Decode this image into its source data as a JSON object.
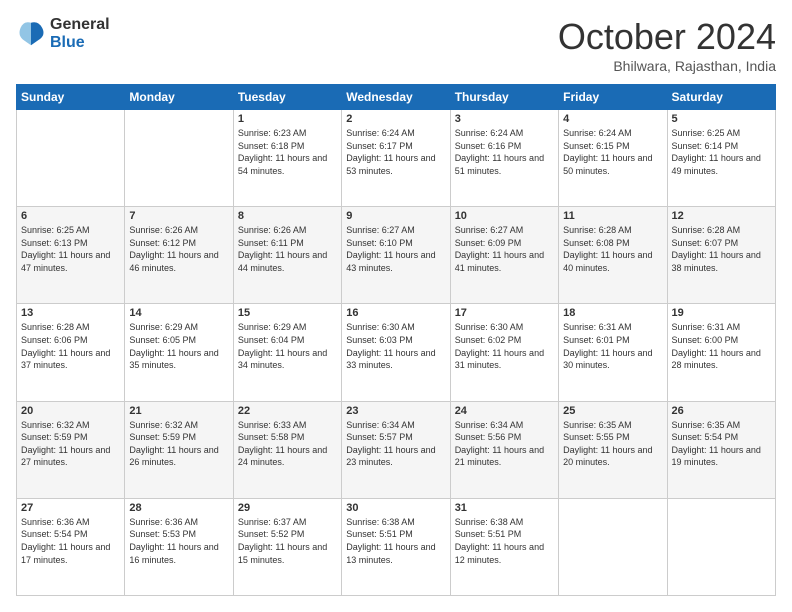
{
  "logo": {
    "general": "General",
    "blue": "Blue"
  },
  "header": {
    "month": "October 2024",
    "location": "Bhilwara, Rajasthan, India"
  },
  "weekdays": [
    "Sunday",
    "Monday",
    "Tuesday",
    "Wednesday",
    "Thursday",
    "Friday",
    "Saturday"
  ],
  "weeks": [
    [
      {
        "day": "",
        "info": ""
      },
      {
        "day": "",
        "info": ""
      },
      {
        "day": "1",
        "info": "Sunrise: 6:23 AM\nSunset: 6:18 PM\nDaylight: 11 hours and 54 minutes."
      },
      {
        "day": "2",
        "info": "Sunrise: 6:24 AM\nSunset: 6:17 PM\nDaylight: 11 hours and 53 minutes."
      },
      {
        "day": "3",
        "info": "Sunrise: 6:24 AM\nSunset: 6:16 PM\nDaylight: 11 hours and 51 minutes."
      },
      {
        "day": "4",
        "info": "Sunrise: 6:24 AM\nSunset: 6:15 PM\nDaylight: 11 hours and 50 minutes."
      },
      {
        "day": "5",
        "info": "Sunrise: 6:25 AM\nSunset: 6:14 PM\nDaylight: 11 hours and 49 minutes."
      }
    ],
    [
      {
        "day": "6",
        "info": "Sunrise: 6:25 AM\nSunset: 6:13 PM\nDaylight: 11 hours and 47 minutes."
      },
      {
        "day": "7",
        "info": "Sunrise: 6:26 AM\nSunset: 6:12 PM\nDaylight: 11 hours and 46 minutes."
      },
      {
        "day": "8",
        "info": "Sunrise: 6:26 AM\nSunset: 6:11 PM\nDaylight: 11 hours and 44 minutes."
      },
      {
        "day": "9",
        "info": "Sunrise: 6:27 AM\nSunset: 6:10 PM\nDaylight: 11 hours and 43 minutes."
      },
      {
        "day": "10",
        "info": "Sunrise: 6:27 AM\nSunset: 6:09 PM\nDaylight: 11 hours and 41 minutes."
      },
      {
        "day": "11",
        "info": "Sunrise: 6:28 AM\nSunset: 6:08 PM\nDaylight: 11 hours and 40 minutes."
      },
      {
        "day": "12",
        "info": "Sunrise: 6:28 AM\nSunset: 6:07 PM\nDaylight: 11 hours and 38 minutes."
      }
    ],
    [
      {
        "day": "13",
        "info": "Sunrise: 6:28 AM\nSunset: 6:06 PM\nDaylight: 11 hours and 37 minutes."
      },
      {
        "day": "14",
        "info": "Sunrise: 6:29 AM\nSunset: 6:05 PM\nDaylight: 11 hours and 35 minutes."
      },
      {
        "day": "15",
        "info": "Sunrise: 6:29 AM\nSunset: 6:04 PM\nDaylight: 11 hours and 34 minutes."
      },
      {
        "day": "16",
        "info": "Sunrise: 6:30 AM\nSunset: 6:03 PM\nDaylight: 11 hours and 33 minutes."
      },
      {
        "day": "17",
        "info": "Sunrise: 6:30 AM\nSunset: 6:02 PM\nDaylight: 11 hours and 31 minutes."
      },
      {
        "day": "18",
        "info": "Sunrise: 6:31 AM\nSunset: 6:01 PM\nDaylight: 11 hours and 30 minutes."
      },
      {
        "day": "19",
        "info": "Sunrise: 6:31 AM\nSunset: 6:00 PM\nDaylight: 11 hours and 28 minutes."
      }
    ],
    [
      {
        "day": "20",
        "info": "Sunrise: 6:32 AM\nSunset: 5:59 PM\nDaylight: 11 hours and 27 minutes."
      },
      {
        "day": "21",
        "info": "Sunrise: 6:32 AM\nSunset: 5:59 PM\nDaylight: 11 hours and 26 minutes."
      },
      {
        "day": "22",
        "info": "Sunrise: 6:33 AM\nSunset: 5:58 PM\nDaylight: 11 hours and 24 minutes."
      },
      {
        "day": "23",
        "info": "Sunrise: 6:34 AM\nSunset: 5:57 PM\nDaylight: 11 hours and 23 minutes."
      },
      {
        "day": "24",
        "info": "Sunrise: 6:34 AM\nSunset: 5:56 PM\nDaylight: 11 hours and 21 minutes."
      },
      {
        "day": "25",
        "info": "Sunrise: 6:35 AM\nSunset: 5:55 PM\nDaylight: 11 hours and 20 minutes."
      },
      {
        "day": "26",
        "info": "Sunrise: 6:35 AM\nSunset: 5:54 PM\nDaylight: 11 hours and 19 minutes."
      }
    ],
    [
      {
        "day": "27",
        "info": "Sunrise: 6:36 AM\nSunset: 5:54 PM\nDaylight: 11 hours and 17 minutes."
      },
      {
        "day": "28",
        "info": "Sunrise: 6:36 AM\nSunset: 5:53 PM\nDaylight: 11 hours and 16 minutes."
      },
      {
        "day": "29",
        "info": "Sunrise: 6:37 AM\nSunset: 5:52 PM\nDaylight: 11 hours and 15 minutes."
      },
      {
        "day": "30",
        "info": "Sunrise: 6:38 AM\nSunset: 5:51 PM\nDaylight: 11 hours and 13 minutes."
      },
      {
        "day": "31",
        "info": "Sunrise: 6:38 AM\nSunset: 5:51 PM\nDaylight: 11 hours and 12 minutes."
      },
      {
        "day": "",
        "info": ""
      },
      {
        "day": "",
        "info": ""
      }
    ]
  ]
}
